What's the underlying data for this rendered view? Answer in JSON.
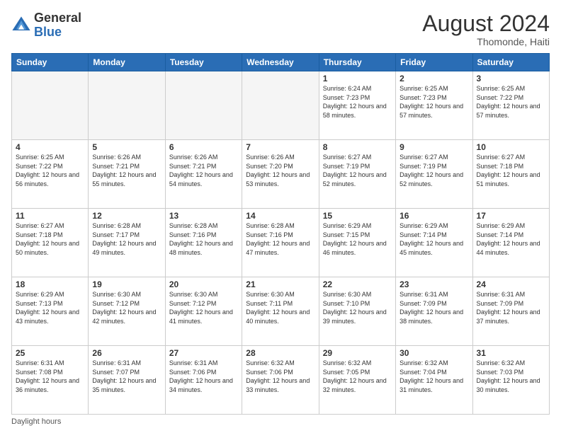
{
  "header": {
    "logo_general": "General",
    "logo_blue": "Blue",
    "month_year": "August 2024",
    "location": "Thomonde, Haiti"
  },
  "days_of_week": [
    "Sunday",
    "Monday",
    "Tuesday",
    "Wednesday",
    "Thursday",
    "Friday",
    "Saturday"
  ],
  "weeks": [
    [
      {
        "day": "",
        "sunrise": "",
        "sunset": "",
        "daylight": ""
      },
      {
        "day": "",
        "sunrise": "",
        "sunset": "",
        "daylight": ""
      },
      {
        "day": "",
        "sunrise": "",
        "sunset": "",
        "daylight": ""
      },
      {
        "day": "",
        "sunrise": "",
        "sunset": "",
        "daylight": ""
      },
      {
        "day": "1",
        "sunrise": "Sunrise: 6:24 AM",
        "sunset": "Sunset: 7:23 PM",
        "daylight": "Daylight: 12 hours and 58 minutes."
      },
      {
        "day": "2",
        "sunrise": "Sunrise: 6:25 AM",
        "sunset": "Sunset: 7:23 PM",
        "daylight": "Daylight: 12 hours and 57 minutes."
      },
      {
        "day": "3",
        "sunrise": "Sunrise: 6:25 AM",
        "sunset": "Sunset: 7:22 PM",
        "daylight": "Daylight: 12 hours and 57 minutes."
      }
    ],
    [
      {
        "day": "4",
        "sunrise": "Sunrise: 6:25 AM",
        "sunset": "Sunset: 7:22 PM",
        "daylight": "Daylight: 12 hours and 56 minutes."
      },
      {
        "day": "5",
        "sunrise": "Sunrise: 6:26 AM",
        "sunset": "Sunset: 7:21 PM",
        "daylight": "Daylight: 12 hours and 55 minutes."
      },
      {
        "day": "6",
        "sunrise": "Sunrise: 6:26 AM",
        "sunset": "Sunset: 7:21 PM",
        "daylight": "Daylight: 12 hours and 54 minutes."
      },
      {
        "day": "7",
        "sunrise": "Sunrise: 6:26 AM",
        "sunset": "Sunset: 7:20 PM",
        "daylight": "Daylight: 12 hours and 53 minutes."
      },
      {
        "day": "8",
        "sunrise": "Sunrise: 6:27 AM",
        "sunset": "Sunset: 7:19 PM",
        "daylight": "Daylight: 12 hours and 52 minutes."
      },
      {
        "day": "9",
        "sunrise": "Sunrise: 6:27 AM",
        "sunset": "Sunset: 7:19 PM",
        "daylight": "Daylight: 12 hours and 52 minutes."
      },
      {
        "day": "10",
        "sunrise": "Sunrise: 6:27 AM",
        "sunset": "Sunset: 7:18 PM",
        "daylight": "Daylight: 12 hours and 51 minutes."
      }
    ],
    [
      {
        "day": "11",
        "sunrise": "Sunrise: 6:27 AM",
        "sunset": "Sunset: 7:18 PM",
        "daylight": "Daylight: 12 hours and 50 minutes."
      },
      {
        "day": "12",
        "sunrise": "Sunrise: 6:28 AM",
        "sunset": "Sunset: 7:17 PM",
        "daylight": "Daylight: 12 hours and 49 minutes."
      },
      {
        "day": "13",
        "sunrise": "Sunrise: 6:28 AM",
        "sunset": "Sunset: 7:16 PM",
        "daylight": "Daylight: 12 hours and 48 minutes."
      },
      {
        "day": "14",
        "sunrise": "Sunrise: 6:28 AM",
        "sunset": "Sunset: 7:16 PM",
        "daylight": "Daylight: 12 hours and 47 minutes."
      },
      {
        "day": "15",
        "sunrise": "Sunrise: 6:29 AM",
        "sunset": "Sunset: 7:15 PM",
        "daylight": "Daylight: 12 hours and 46 minutes."
      },
      {
        "day": "16",
        "sunrise": "Sunrise: 6:29 AM",
        "sunset": "Sunset: 7:14 PM",
        "daylight": "Daylight: 12 hours and 45 minutes."
      },
      {
        "day": "17",
        "sunrise": "Sunrise: 6:29 AM",
        "sunset": "Sunset: 7:14 PM",
        "daylight": "Daylight: 12 hours and 44 minutes."
      }
    ],
    [
      {
        "day": "18",
        "sunrise": "Sunrise: 6:29 AM",
        "sunset": "Sunset: 7:13 PM",
        "daylight": "Daylight: 12 hours and 43 minutes."
      },
      {
        "day": "19",
        "sunrise": "Sunrise: 6:30 AM",
        "sunset": "Sunset: 7:12 PM",
        "daylight": "Daylight: 12 hours and 42 minutes."
      },
      {
        "day": "20",
        "sunrise": "Sunrise: 6:30 AM",
        "sunset": "Sunset: 7:12 PM",
        "daylight": "Daylight: 12 hours and 41 minutes."
      },
      {
        "day": "21",
        "sunrise": "Sunrise: 6:30 AM",
        "sunset": "Sunset: 7:11 PM",
        "daylight": "Daylight: 12 hours and 40 minutes."
      },
      {
        "day": "22",
        "sunrise": "Sunrise: 6:30 AM",
        "sunset": "Sunset: 7:10 PM",
        "daylight": "Daylight: 12 hours and 39 minutes."
      },
      {
        "day": "23",
        "sunrise": "Sunrise: 6:31 AM",
        "sunset": "Sunset: 7:09 PM",
        "daylight": "Daylight: 12 hours and 38 minutes."
      },
      {
        "day": "24",
        "sunrise": "Sunrise: 6:31 AM",
        "sunset": "Sunset: 7:09 PM",
        "daylight": "Daylight: 12 hours and 37 minutes."
      }
    ],
    [
      {
        "day": "25",
        "sunrise": "Sunrise: 6:31 AM",
        "sunset": "Sunset: 7:08 PM",
        "daylight": "Daylight: 12 hours and 36 minutes."
      },
      {
        "day": "26",
        "sunrise": "Sunrise: 6:31 AM",
        "sunset": "Sunset: 7:07 PM",
        "daylight": "Daylight: 12 hours and 35 minutes."
      },
      {
        "day": "27",
        "sunrise": "Sunrise: 6:31 AM",
        "sunset": "Sunset: 7:06 PM",
        "daylight": "Daylight: 12 hours and 34 minutes."
      },
      {
        "day": "28",
        "sunrise": "Sunrise: 6:32 AM",
        "sunset": "Sunset: 7:06 PM",
        "daylight": "Daylight: 12 hours and 33 minutes."
      },
      {
        "day": "29",
        "sunrise": "Sunrise: 6:32 AM",
        "sunset": "Sunset: 7:05 PM",
        "daylight": "Daylight: 12 hours and 32 minutes."
      },
      {
        "day": "30",
        "sunrise": "Sunrise: 6:32 AM",
        "sunset": "Sunset: 7:04 PM",
        "daylight": "Daylight: 12 hours and 31 minutes."
      },
      {
        "day": "31",
        "sunrise": "Sunrise: 6:32 AM",
        "sunset": "Sunset: 7:03 PM",
        "daylight": "Daylight: 12 hours and 30 minutes."
      }
    ]
  ],
  "footer": {
    "note": "Daylight hours"
  }
}
